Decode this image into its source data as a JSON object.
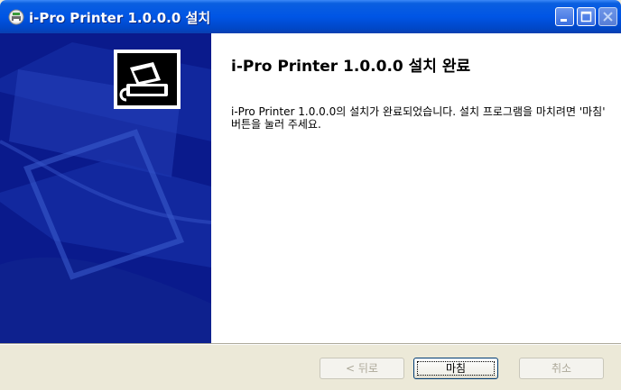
{
  "window": {
    "title": "i-Pro Printer 1.0.0.0 설치"
  },
  "content": {
    "heading": "i-Pro Printer 1.0.0.0 설치 완료",
    "description": "i-Pro Printer 1.0.0.0의 설치가 완료되었습니다. 설치 프로그램을 마치려면 '마침' 버튼을 눌러 주세요."
  },
  "buttons": {
    "back": "< 뒤로",
    "finish": "마침",
    "cancel": "취소"
  },
  "icons": {
    "title": "installer-icon",
    "banner": "printer-icon"
  },
  "colors": {
    "titlebar": "#0055e5",
    "banner": "#0a1a8c",
    "dialog_bg": "#ece9d8"
  }
}
